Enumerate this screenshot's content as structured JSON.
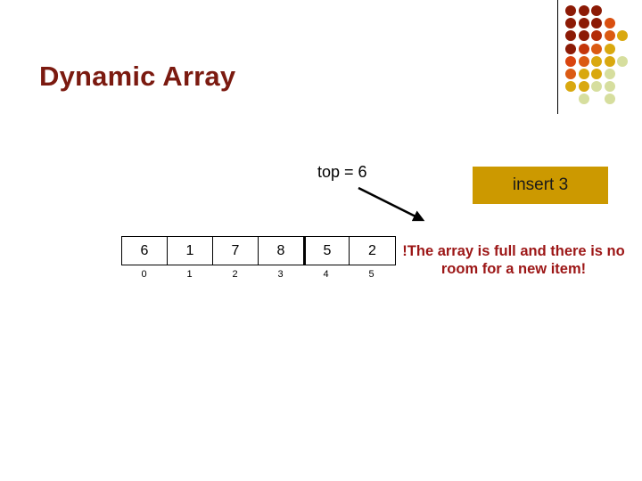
{
  "slide": {
    "title": "Dynamic Array"
  },
  "logo": {
    "name": "decorative-dot-grid",
    "rows": [
      [
        {
          "c": "#8C1A05"
        },
        {
          "c": "#8C1A05"
        },
        {
          "c": "#8C1A05"
        }
      ],
      [
        {
          "c": "#8C1A05"
        },
        {
          "c": "#8C1A05"
        },
        {
          "c": "#8C1A05"
        },
        {
          "c": "#D94F10"
        }
      ],
      [
        {
          "c": "#8C1A05"
        },
        {
          "c": "#8C1A05"
        },
        {
          "c": "#B32D08"
        },
        {
          "c": "#DB5A12"
        },
        {
          "c": "#D9A80F"
        }
      ],
      [
        {
          "c": "#8C1A05"
        },
        {
          "c": "#C4360A"
        },
        {
          "c": "#DB5A12"
        },
        {
          "c": "#D9A80F"
        }
      ],
      [
        {
          "c": "#D9440E"
        },
        {
          "c": "#DB5A12"
        },
        {
          "c": "#D9A80F"
        },
        {
          "c": "#D9A80F"
        },
        {
          "c": "#D6DE9E"
        }
      ],
      [
        {
          "c": "#DB5A12"
        },
        {
          "c": "#D9A80F"
        },
        {
          "c": "#D9A80F"
        },
        {
          "c": "#D6DE9E"
        }
      ],
      [
        {
          "c": "#D9A80F"
        },
        {
          "c": "#D9A80F"
        },
        {
          "c": "#D6DE9E"
        },
        {
          "c": "#D6DE9E"
        }
      ],
      [
        {
          "c": "#D6DE9E"
        },
        {
          "c": "#D6DE9E"
        }
      ]
    ]
  },
  "annotation": {
    "top_label": "top = 6",
    "arrow_name": "top-pointer-arrow"
  },
  "callout": {
    "insert_label": "insert 3",
    "background_color": "#CC9900"
  },
  "array": {
    "values": [
      "6",
      "1",
      "7",
      "8",
      "5",
      "2"
    ],
    "indices": [
      "0",
      "1",
      "2",
      "3",
      "4",
      "5"
    ],
    "thick_divider_before_index": 4
  },
  "warning": {
    "text": "!The array is full and there is no room for a new item!",
    "color": "#9C1616"
  }
}
